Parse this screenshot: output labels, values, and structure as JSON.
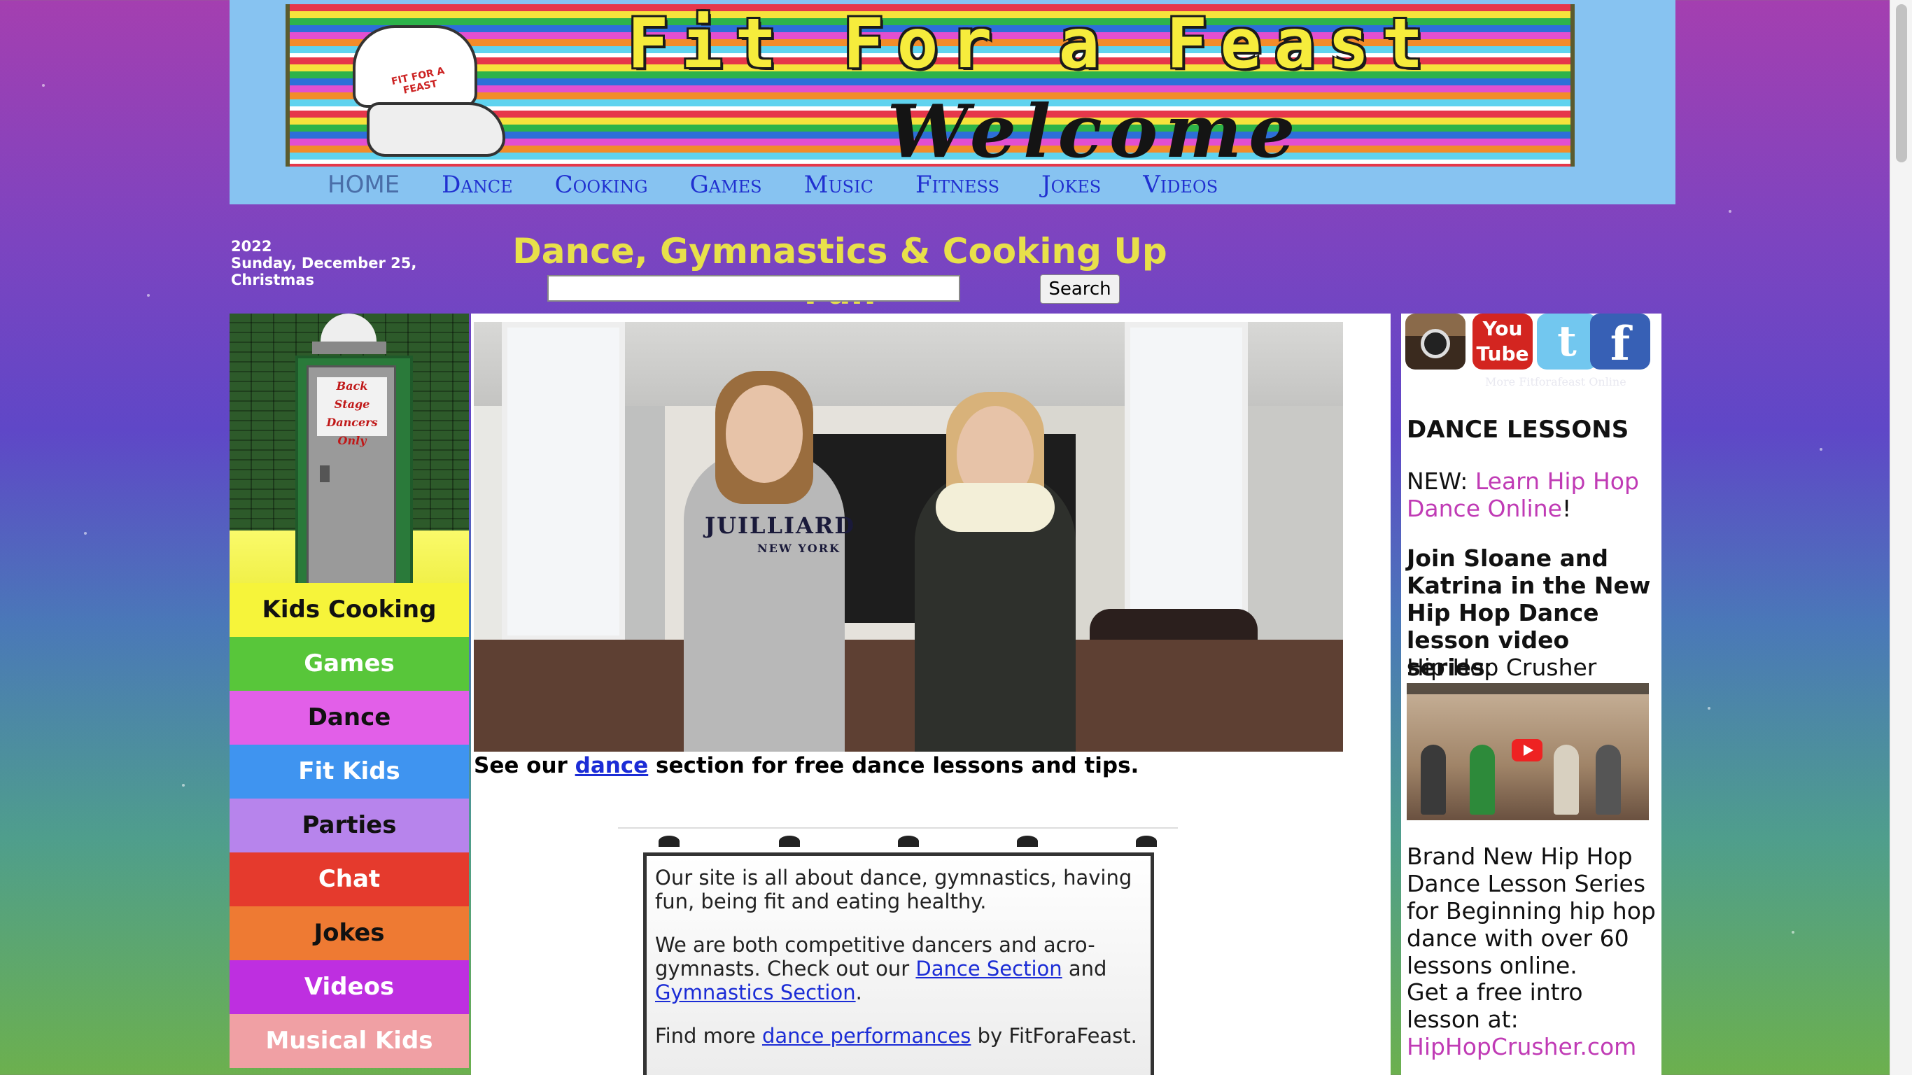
{
  "header": {
    "banner_title": "Fit For a Feast",
    "banner_sub": "Welcome",
    "chef_label": "FIT FOR A FEAST",
    "nav": [
      "HOME",
      "Dance",
      "Cooking",
      "Games",
      "Music",
      "Fitness",
      "Jokes",
      "Videos"
    ]
  },
  "date": {
    "year": "2022",
    "day": "Sunday, December 25,",
    "holiday": "Christmas"
  },
  "headline": "Dance, Gymnastics & Cooking Up Fun",
  "search": {
    "button": "Search",
    "value": ""
  },
  "backstage": {
    "sign": [
      "Back Stage",
      "Dancers",
      "Only"
    ]
  },
  "sidebar": {
    "items": [
      {
        "label": "Kids Cooking",
        "color": "#f6f43a",
        "text": "dark"
      },
      {
        "label": "Games",
        "color": "#58c63a",
        "text": "light"
      },
      {
        "label": "Dance",
        "color": "#e25fe8",
        "text": "dark"
      },
      {
        "label": "Fit Kids",
        "color": "#3f94f0",
        "text": "light"
      },
      {
        "label": "Parties",
        "color": "#b784ec",
        "text": "dark"
      },
      {
        "label": "Chat",
        "color": "#e53a2d",
        "text": "light"
      },
      {
        "label": "Jokes",
        "color": "#ee7a33",
        "text": "dark"
      },
      {
        "label": "Videos",
        "color": "#be2fe0",
        "text": "light"
      },
      {
        "label": "Musical Kids",
        "color": "#f0a0a4",
        "text": "light"
      }
    ]
  },
  "hero": {
    "hoodie_text": "JUILLIARD",
    "hoodie_sub": "NEW YORK"
  },
  "caption": {
    "pre": "See our ",
    "link": "dance",
    "post": " section for free dance lessons and tips."
  },
  "info": {
    "p1": "Our site is all about dance, gymnastics, having fun, being fit and eating healthy.",
    "p2_pre": "We are both competitive dancers and acro-gymnasts. Check out our ",
    "p2_link1": "Dance Section",
    "p2_mid": " and ",
    "p2_link2": "Gymnastics Section",
    "p2_post": ".",
    "p3_pre": "Find more ",
    "p3_link": "dance performances",
    "p3_post": " by FitForaFeast."
  },
  "right": {
    "social": [
      {
        "name": "instagram-icon",
        "color": "#6b4a34"
      },
      {
        "name": "youtube-icon",
        "color": "#d32520"
      },
      {
        "name": "twitter-icon",
        "color": "#72c7ef"
      },
      {
        "name": "facebook-icon",
        "color": "#3760b5"
      }
    ],
    "social_youtube_text": "You Tube",
    "social_caption": "More Fitforafeast Online",
    "lessons_heading": "DANCE LESSONS",
    "new_pre": "NEW: ",
    "new_link": "Learn Hip Hop Dance Online",
    "new_post": "!",
    "join_bold": "Join Sloane and Katrina in the New Hip Hop Dance lesson video series",
    "join_colon": ":",
    "series_name": "Hip Hop Crusher",
    "brand_new": "Brand New Hip Hop Dance Lesson Series for Beginning hip hop dance with over 60 lessons online.",
    "free_intro": "Get a free intro lesson at:",
    "site_link": "HipHopCrusher.com"
  }
}
